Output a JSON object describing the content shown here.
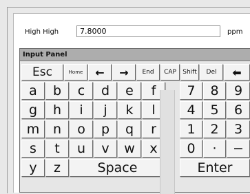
{
  "field": {
    "label": "High High",
    "value": "7.8000",
    "unit": "ppm"
  },
  "panel": {
    "title": "Input Panel"
  },
  "keys": {
    "esc": "Esc",
    "home": "Home",
    "left_arrow": "←",
    "right_arrow": "→",
    "end": "End",
    "cap": "CAP",
    "shift": "Shift",
    "del": "Del",
    "backspace": "⬅",
    "letters_row1": [
      "a",
      "b",
      "c",
      "d",
      "e",
      "f"
    ],
    "letters_row2": [
      "g",
      "h",
      "i",
      "j",
      "k",
      "l"
    ],
    "letters_row3": [
      "m",
      "n",
      "o",
      "p",
      "q",
      "r"
    ],
    "letters_row4": [
      "s",
      "t",
      "u",
      "v",
      "w",
      "x"
    ],
    "letters_row5": [
      "y",
      "z"
    ],
    "space": "Space",
    "num_row1": [
      "7",
      "8",
      "9"
    ],
    "num_row2": [
      "4",
      "5",
      "6"
    ],
    "num_row3": [
      "1",
      "2",
      "3"
    ],
    "num_row4": [
      "0",
      "·",
      "−"
    ],
    "enter": "Enter"
  }
}
